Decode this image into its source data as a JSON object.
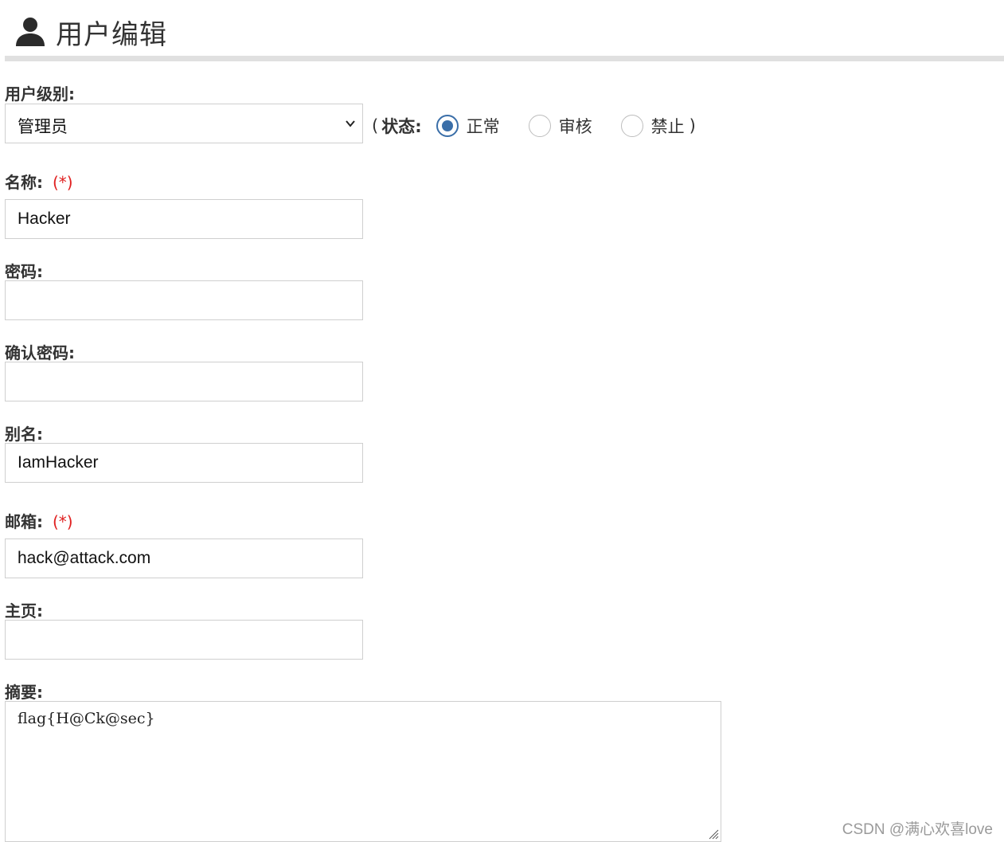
{
  "header": {
    "icon": "user-icon",
    "title": "用户编辑"
  },
  "form": {
    "level": {
      "label": "用户级别:",
      "selected": "管理员"
    },
    "status": {
      "open_paren": "(",
      "label": "状态:",
      "options": [
        "正常",
        "审核",
        "禁止"
      ],
      "selected_index": 0,
      "close_paren": ")"
    },
    "name": {
      "label": "名称:",
      "required": "(*)",
      "value": "Hacker"
    },
    "password": {
      "label": "密码:",
      "value": ""
    },
    "confirm_password": {
      "label": "确认密码:",
      "value": ""
    },
    "alias": {
      "label": "别名:",
      "value": "IamHacker"
    },
    "email": {
      "label": "邮箱:",
      "required": "(*)",
      "value": "hack@attack.com"
    },
    "homepage": {
      "label": "主页:",
      "value": ""
    },
    "summary": {
      "label": "摘要:",
      "value": "flag{H@Ck@sec}"
    }
  },
  "watermark": "CSDN @满心欢喜love",
  "colors": {
    "accent": "#3a6ea8",
    "required": "#e02020",
    "divider": "#e0e0e0",
    "border": "#cfcfcf"
  }
}
